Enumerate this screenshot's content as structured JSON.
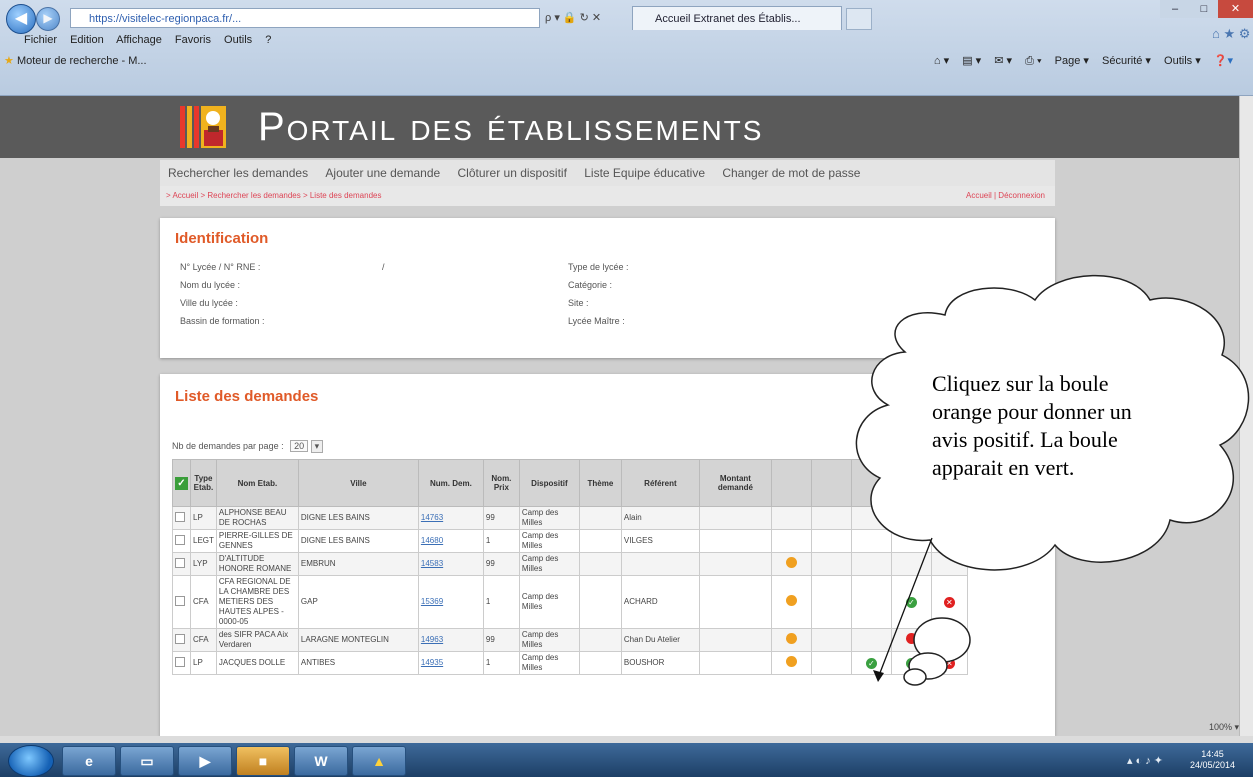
{
  "browser": {
    "address": "https://visitelec-regionpaca.fr/...",
    "address_tools": "ρ ▾ 🔒 ↻ ✕",
    "tab_title": "Accueil Extranet des Établis...",
    "menu": [
      "Fichier",
      "Edition",
      "Affichage",
      "Favoris",
      "Outils",
      "?"
    ],
    "favorites": "Moteur de recherche - M...",
    "command_bar": [
      "Page ▾",
      "Sécurité ▾",
      "Outils ▾"
    ]
  },
  "site": {
    "title": "Portail des établissements",
    "nav": [
      "Rechercher les demandes",
      "Ajouter une demande",
      "Clôturer un dispositif",
      "Liste Equipe éducative",
      "Changer de mot de passe"
    ],
    "breadcrumb": "> Accueil > Rechercher les demandes > Liste des demandes",
    "breadcrumb_right": "Accueil | Déconnexion"
  },
  "identification": {
    "title": "Identification",
    "left_fields": [
      "N° Lycée / N° RNE :",
      "Nom du lycée :",
      "Ville du lycée :",
      "Bassin de formation :"
    ],
    "separator": "/",
    "right_fields": [
      "Type de lycée :",
      "Catégorie :",
      "Site :",
      "Lycée Maître :"
    ]
  },
  "list": {
    "title": "Liste des demandes",
    "per_page_label": "Nb de demandes par page :",
    "per_page_value": "20",
    "headers": [
      "Type Etab.",
      "Nom Etab.",
      "Ville",
      "Num. Dem.",
      "Nom. Prix",
      "Dispositif",
      "Thème",
      "Référent",
      "Montant demandé"
    ],
    "rows": [
      {
        "type": "LP",
        "name": "ALPHONSE BEAU DE ROCHAS",
        "city": "DIGNE LES BAINS",
        "num": "14763",
        "prix": "99",
        "disp": "Camp des Milles",
        "theme": "",
        "ref": "Alain",
        "dots": [
          "",
          "",
          "",
          "",
          ""
        ]
      },
      {
        "type": "LEGT",
        "name": "PIERRE-GILLES DE GENNES",
        "city": "DIGNE LES BAINS",
        "num": "14680",
        "prix": "1",
        "disp": "Camp des Milles",
        "theme": "",
        "ref": "VILGES",
        "dots": [
          "",
          "",
          "",
          "",
          ""
        ]
      },
      {
        "type": "LYP",
        "name": "D'ALTITUDE HONORE ROMANE",
        "city": "EMBRUN",
        "num": "14583",
        "prix": "99",
        "disp": "Camp des Milles",
        "theme": "",
        "ref": "",
        "dots": [
          "orange",
          "",
          "",
          "",
          ""
        ]
      },
      {
        "type": "CFA",
        "name": "CFA REGIONAL DE LA CHAMBRE DES METIERS DES HAUTES ALPES - 0000-05",
        "city": "GAP",
        "num": "15369",
        "prix": "1",
        "disp": "Camp des Milles",
        "theme": "",
        "ref": "ACHARD",
        "dots": [
          "orange",
          "",
          "",
          "green",
          "red"
        ]
      },
      {
        "type": "CFA",
        "name": "des SIFR PACA Aix Verdaren",
        "city": "LARAGNE MONTEGLIN",
        "num": "14963",
        "prix": "99",
        "disp": "Camp des Milles",
        "theme": "",
        "ref": "Chan Du Atelier",
        "dots": [
          "orange",
          "",
          "",
          "redball",
          "red"
        ]
      },
      {
        "type": "LP",
        "name": "JACQUES DOLLE",
        "city": "ANTIBES",
        "num": "14935",
        "prix": "1",
        "disp": "Camp des Milles",
        "theme": "",
        "ref": "BOUSHOR",
        "dots": [
          "orange",
          "",
          "green",
          "green",
          "red"
        ]
      }
    ]
  },
  "callout": {
    "text": "Cliquez sur la boule orange pour donner un avis positif. La boule apparait en vert."
  },
  "status": {
    "zoom": "100% ▾",
    "time": "14:45",
    "date": "24/05/2014"
  },
  "colors": {
    "accent": "#e05a28",
    "orange_dot": "#f0a020",
    "green_dot": "#3aa040",
    "red_dot": "#e02020",
    "banner": "#5a5a5a"
  }
}
